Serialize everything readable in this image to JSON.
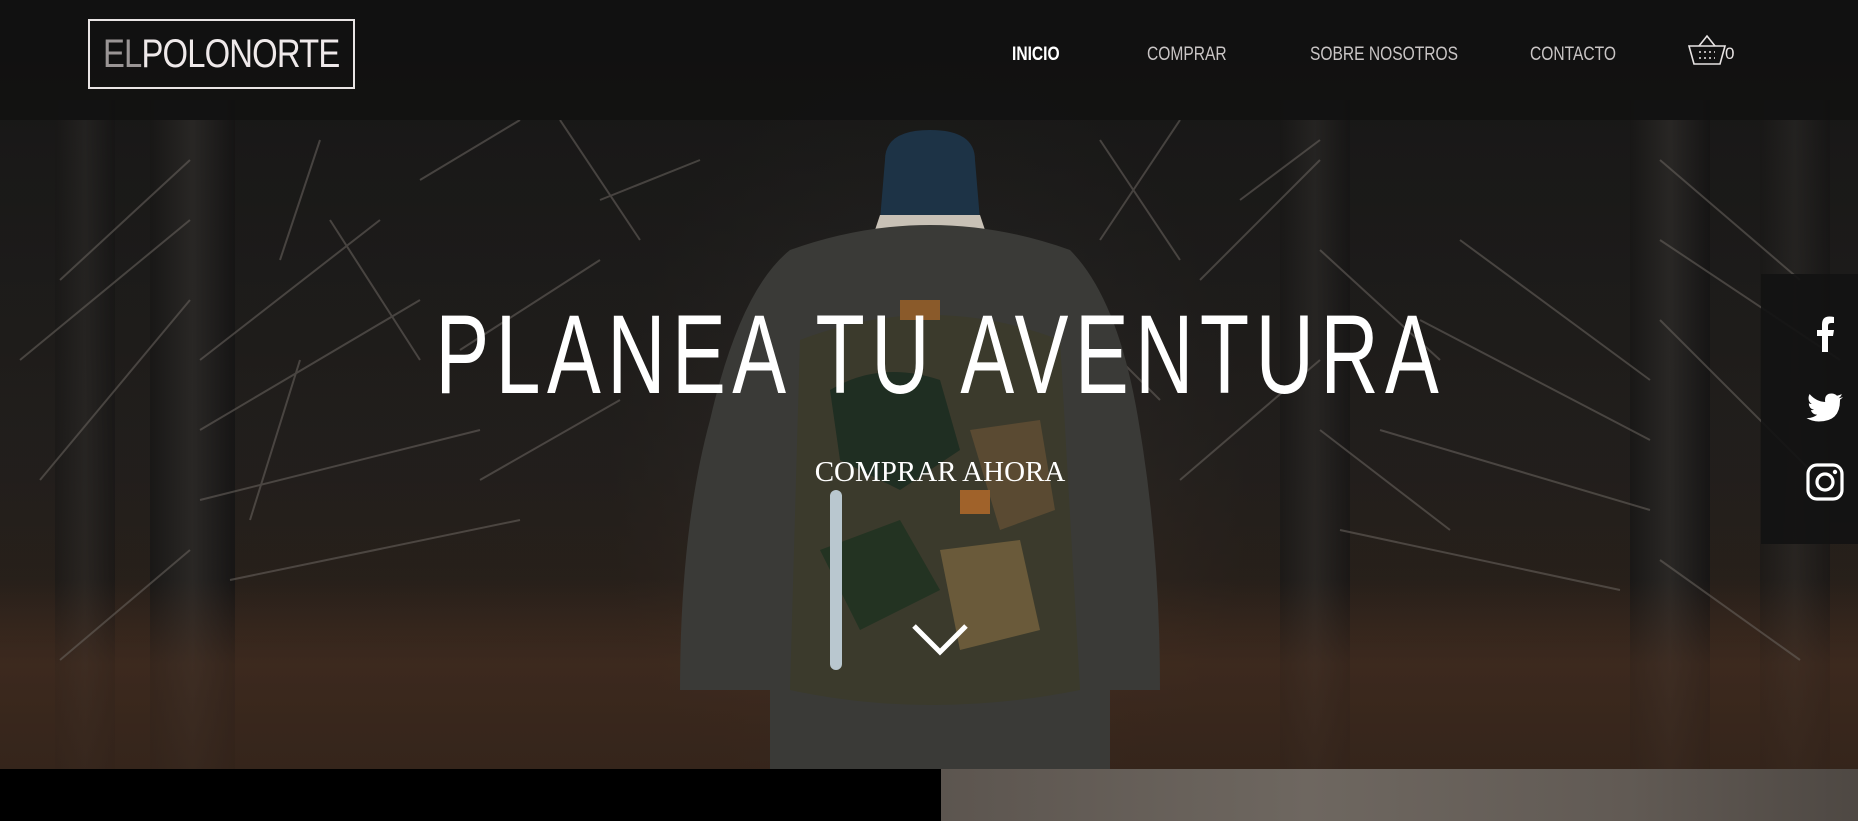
{
  "brand": {
    "logo_prefix": "EL",
    "logo_main": "POLONORTE"
  },
  "nav": {
    "items": [
      {
        "label": "INICIO",
        "active": true
      },
      {
        "label": "COMPRAR",
        "active": false
      },
      {
        "label": "SOBRE NOSOTROS",
        "active": false
      },
      {
        "label": "CONTACTO",
        "active": false
      }
    ],
    "cart_count": "0",
    "cart_icon": "basket-icon"
  },
  "hero": {
    "headline": "PLANEA TU AVENTURA",
    "cta_label": "COMPRAR AHORA",
    "scroll_icon": "chevron-down-icon"
  },
  "social": {
    "icons": [
      "facebook-icon",
      "twitter-icon",
      "instagram-icon"
    ]
  },
  "colors": {
    "header_bg": "#121212",
    "text_primary": "#ffffff",
    "nav_text": "#c9c5c5",
    "logo_dim": "#9a9595"
  }
}
